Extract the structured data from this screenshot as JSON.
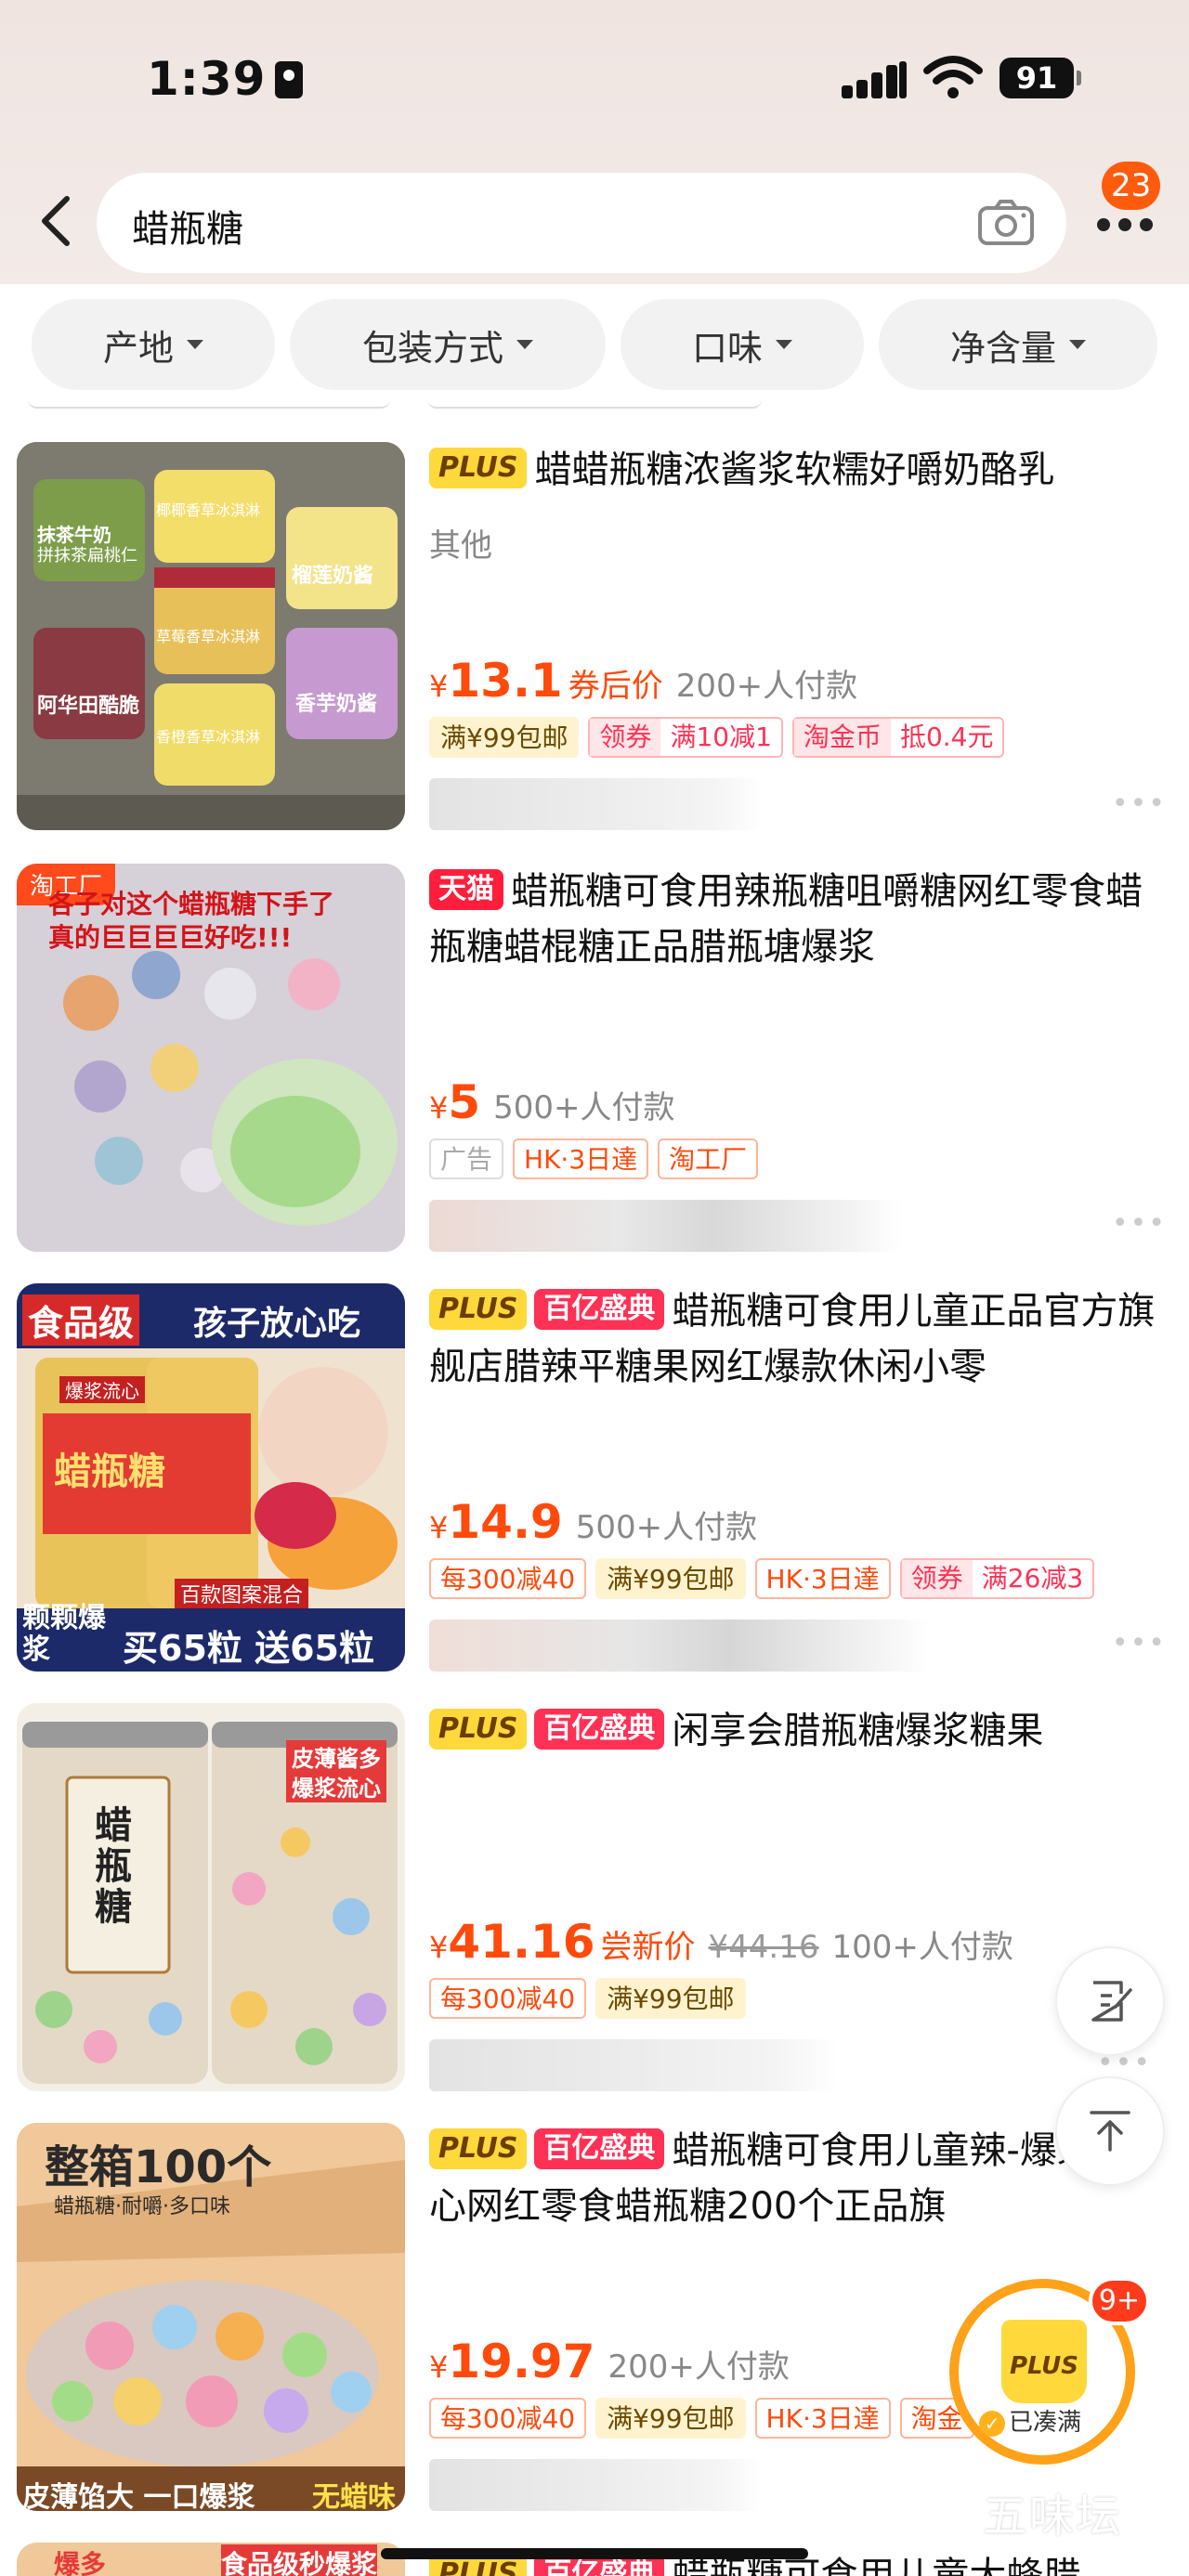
{
  "status": {
    "time": "1:39",
    "battery": "91"
  },
  "search": {
    "query": "蜡瓶糖",
    "cart_badge": "23"
  },
  "filters": [
    "产地",
    "包装方式",
    "口味",
    "净含量"
  ],
  "products": [
    {
      "badges": [
        "PLUS"
      ],
      "title": "蜡蜡瓶糖浓酱浆软糯好嚼奶酪乳",
      "subtitle": "其他",
      "yen": "¥",
      "price": "13.1",
      "price_tag": "券后价",
      "old_price": "",
      "sales": "200+人付款",
      "tags": [
        "满¥99包邮"
      ],
      "coupon": [
        "领券",
        "满10减1"
      ],
      "coupon2": [
        "淘金币",
        "抵0.4元"
      ],
      "thumb_texts": [
        "抹茶牛奶",
        "拼抹茶扁桃仁",
        "椰椰香草冰淇淋",
        "榴莲奶酱",
        "草莓香草冰淇淋",
        "阿华田酷脆",
        "香芋奶酱",
        "香橙香草冰淇淋"
      ]
    },
    {
      "badges": [
        "天猫"
      ],
      "title": "蜡瓶糖可食用辣瓶糖咀嚼糖网红零食蜡瓶糖蜡棍糖正品腊瓶塘爆浆",
      "subtitle": "",
      "yen": "¥",
      "price": "5",
      "price_tag": "",
      "old_price": "",
      "sales": "500+人付款",
      "tags": [
        "广告",
        "HK·3日達",
        "淘工厂"
      ],
      "thumb_tag": "淘工厂",
      "thumb_texts": [
        "各子对这个蜡瓶糖下手了",
        "真的巨巨巨巨好吃!!!"
      ]
    },
    {
      "badges": [
        "PLUS",
        "百亿盛典"
      ],
      "title": "蜡瓶糖可食用儿童正品官方旗舰店腊辣平糖果网红爆款休闲小零",
      "subtitle": "",
      "yen": "¥",
      "price": "14.9",
      "price_tag": "",
      "old_price": "",
      "sales": "500+人付款",
      "tags": [
        "每300减40",
        "满¥99包邮",
        "HK·3日達"
      ],
      "coupon": [
        "领券",
        "满26减3"
      ],
      "thumb_texts": [
        "食品级",
        "孩子放心吃",
        "爆浆流心",
        "蜡瓶糖",
        "百款图案混合",
        "颗颗爆浆",
        "买65粒 送65粒"
      ]
    },
    {
      "badges": [
        "PLUS",
        "百亿盛典"
      ],
      "title": "闲享会腊瓶糖爆浆糖果",
      "subtitle": "",
      "yen": "¥",
      "price": "41.16",
      "price_tag": "尝新价",
      "old_price": "¥44.16",
      "sales": "100+人付款",
      "tags": [
        "每300减40",
        "满¥99包邮"
      ],
      "thumb_texts": [
        "皮薄酱多",
        "爆浆流心",
        "蜡瓶糖"
      ]
    },
    {
      "badges": [
        "PLUS",
        "百亿盛典"
      ],
      "title": "蜡瓶糖可食用儿童辣-爆浆夹心网红零食蜡瓶糖200个正品旗",
      "subtitle": "",
      "yen": "¥",
      "price": "19.97",
      "price_tag": "",
      "old_price": "",
      "sales": "200+人付款",
      "tags": [
        "每300减40",
        "满¥99包邮",
        "HK·3日達",
        "淘金"
      ],
      "thumb_texts": [
        "整箱100个",
        "蜡瓶糖·耐嚼·多口味",
        "皮薄馅大 一口爆浆",
        "无蜡味"
      ]
    }
  ],
  "partial_next": {
    "badges": [
      "PLUS",
      "百亿盛典"
    ],
    "title": "蜡瓶糖可食用儿童大蜂腊",
    "thumb_texts": [
      "食品级秒爆浆",
      "爆多"
    ]
  },
  "floating": {
    "cart_badge": "9+",
    "cart_label": "PLUS",
    "cart_status": "已凑满"
  },
  "watermark": "五味坛",
  "colors": {
    "accent": "#ff4a0b",
    "plus": "#ffd83b",
    "bill": "#ff3155"
  }
}
